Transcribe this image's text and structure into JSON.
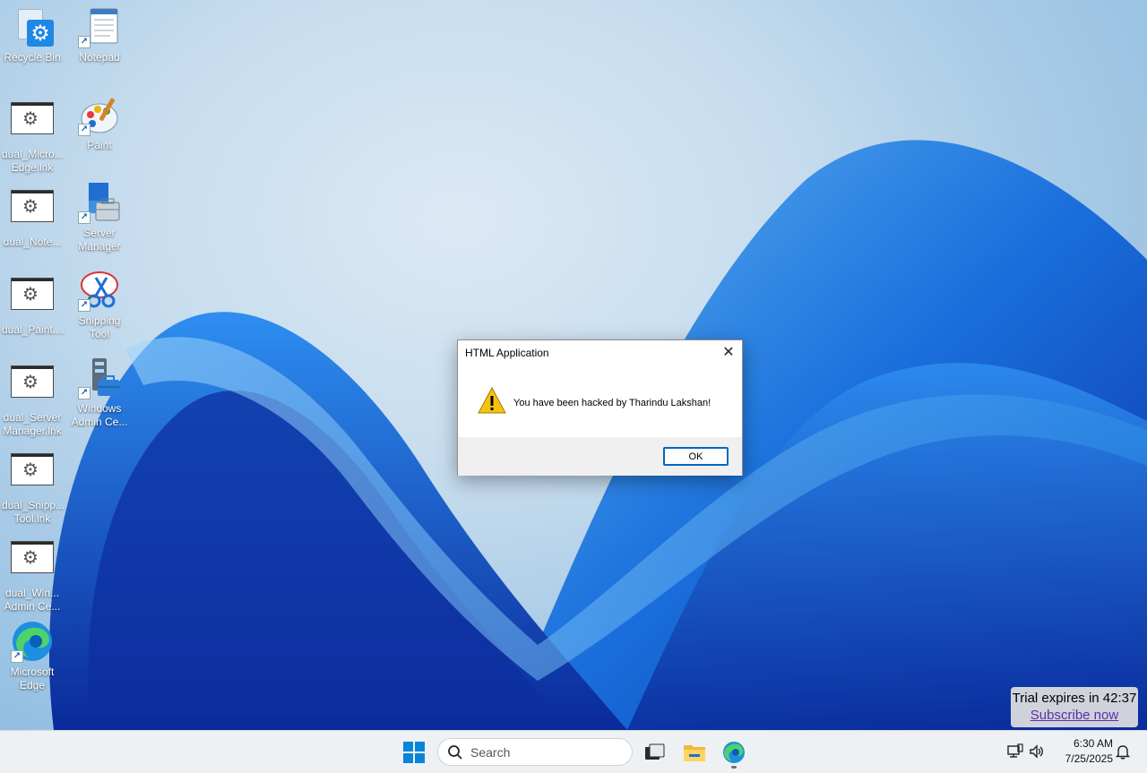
{
  "desktop_icons": [
    {
      "label": "Recycle Bin",
      "icon": "recycle-bin-settings-icon"
    },
    {
      "label": "Notepad",
      "icon": "notepad-icon"
    },
    {
      "label": "dual_Micro... Edge.lnk",
      "icon": "shortcut-gear-icon"
    },
    {
      "label": "Paint",
      "icon": "paint-icon"
    },
    {
      "label": "dual_Note...",
      "icon": "shortcut-gear-icon"
    },
    {
      "label": "Server Manager",
      "icon": "server-manager-icon"
    },
    {
      "label": "dual_Paint....",
      "icon": "shortcut-gear-icon"
    },
    {
      "label": "Snipping Tool",
      "icon": "snipping-tool-icon"
    },
    {
      "label": "dual_Server Manager.lnk",
      "icon": "shortcut-gear-icon"
    },
    {
      "label": "Windows Admin Ce...",
      "icon": "windows-admin-center-icon"
    },
    {
      "label": "dual_Snipp... Tool.lnk",
      "icon": "shortcut-gear-icon"
    },
    {
      "label": "dual_Win... Admin Ce...",
      "icon": "shortcut-gear-icon"
    },
    {
      "label": "Microsoft Edge",
      "icon": "edge-icon"
    }
  ],
  "dialog": {
    "title": "HTML Application",
    "message": "You have been hacked by Tharindu Lakshan!",
    "ok_label": "OK",
    "close_glyph": "✕"
  },
  "trial": {
    "expires_text": "Trial expires in 42:37",
    "subscribe_text": "Subscribe now"
  },
  "taskbar": {
    "search_placeholder": "Search",
    "time": "6:30 AM",
    "date": "7/25/2025"
  },
  "colors": {
    "accent": "#0067c0",
    "warning": "#f5c211",
    "start_blue": "#0a84d8",
    "link_purple": "#5b2ea6"
  }
}
